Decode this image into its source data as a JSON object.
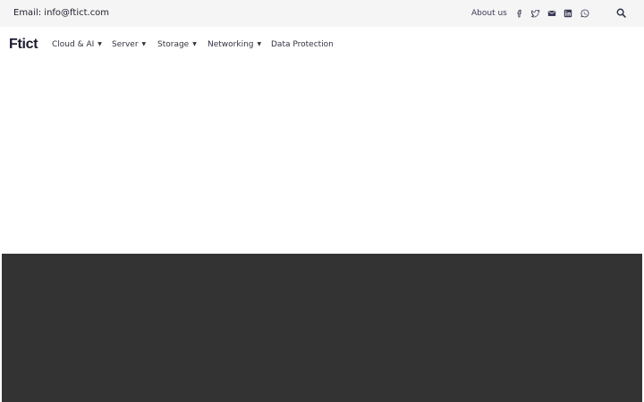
{
  "topbar": {
    "email": "Email: info@ftict.com",
    "about_label": "About us",
    "social_icons": [
      "facebook-icon",
      "twitter-icon",
      "email-icon",
      "linkedin-icon",
      "whatsapp-icon"
    ],
    "search_icon": "search-icon"
  },
  "navbar": {
    "logo": "Ftict",
    "items": [
      {
        "label": "Cloud & AI",
        "has_dropdown": true
      },
      {
        "label": "Server",
        "has_dropdown": true
      },
      {
        "label": "Storage",
        "has_dropdown": true
      },
      {
        "label": "Networking",
        "has_dropdown": true
      },
      {
        "label": "Data Protection",
        "has_dropdown": false
      }
    ],
    "caret_glyph": "▼"
  },
  "colors": {
    "topbar_bg": "#f5f5f5",
    "text_dark": "#1f1f2e",
    "dark_section_bg": "#333333"
  }
}
